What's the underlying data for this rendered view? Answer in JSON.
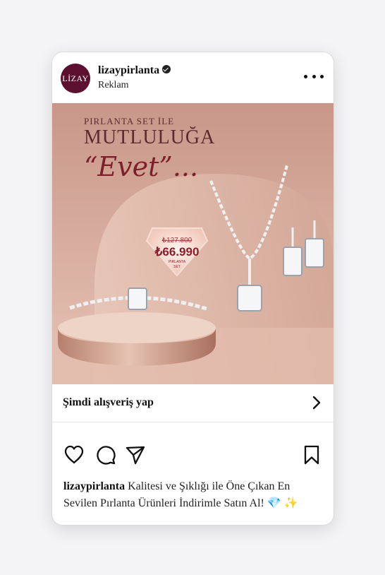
{
  "post": {
    "avatar_text": "LİZAY",
    "username": "lizaypirlanta",
    "sponsored_label": "Reklam",
    "icons": {
      "more": "more-icon",
      "verified": "verified-badge-icon"
    }
  },
  "ad": {
    "headline_small": "PIRLANTA SET İLE",
    "headline_big": "MUTLULUĞA",
    "headline_script": "“Evet”...",
    "old_price": "₺127.800",
    "new_price": "₺66.990",
    "price_caption_1": "PIRLANTA",
    "price_caption_2": "SET",
    "colors": {
      "background": "#c99a8c",
      "accent": "#8a1e2a"
    }
  },
  "cta": {
    "label": "Şimdi alışveriş yap",
    "icon": "chevron-right-icon"
  },
  "actions": {
    "like": "heart-icon",
    "comment": "comment-icon",
    "share": "send-icon",
    "save": "bookmark-icon"
  },
  "caption": {
    "username": "lizaypirlanta",
    "text": " Kalitesi ve Şıklığı ile Öne Çıkan En Sevilen Pırlanta Ürünleri İndirimle Satın Al! 💎 ✨"
  }
}
